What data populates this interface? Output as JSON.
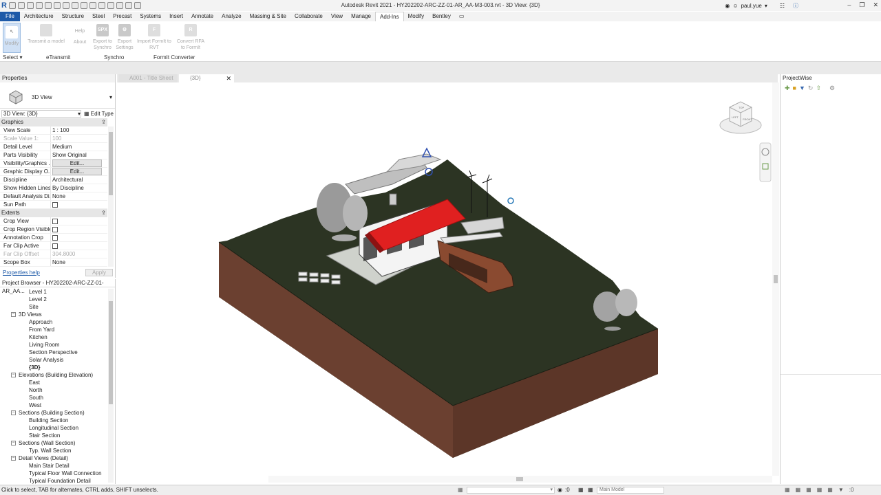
{
  "app": {
    "title": "Autodesk Revit 2021 - HY202202-ARC-ZZ-01-AR_AA-M3-003.rvt - 3D View: {3D}",
    "user": "paul.yue",
    "logo": "R"
  },
  "menu": {
    "tabs": [
      "File",
      "Architecture",
      "Structure",
      "Steel",
      "Precast",
      "Systems",
      "Insert",
      "Annotate",
      "Analyze",
      "Massing & Site",
      "Collaborate",
      "View",
      "Manage",
      "Add-Ins",
      "Modify",
      "Bentley"
    ],
    "active": "Add-Ins"
  },
  "ribbon": {
    "modify": "Modify",
    "transmit": "Transmit a model",
    "help": "Help",
    "about": "About",
    "export_synchro": "Export to Synchro",
    "export_settings": "Export Settings",
    "import_formit": "Import FormIt to RVT",
    "convert_rfa": "Convert RFA to FormIt",
    "spx_icon": "SPX",
    "panels": {
      "select": "Select",
      "etransmit": "eTransmit",
      "synchro": "Synchro",
      "formit": "FormIt Converter"
    }
  },
  "properties": {
    "title": "Properties",
    "type": "3D View",
    "selector": "3D View: {3D}",
    "edit_type": "Edit Type",
    "groups": {
      "graphics": "Graphics",
      "extents": "Extents"
    },
    "graphics_rows": [
      {
        "k": "View Scale",
        "v": "1 : 100"
      },
      {
        "k": "Scale Value    1:",
        "v": "100"
      },
      {
        "k": "Detail Level",
        "v": "Medium"
      },
      {
        "k": "Parts Visibility",
        "v": "Show Original"
      },
      {
        "k": "Visibility/Graphics ...",
        "v": "Edit..."
      },
      {
        "k": "Graphic Display O...",
        "v": "Edit..."
      },
      {
        "k": "Discipline",
        "v": "Architectural"
      },
      {
        "k": "Show Hidden Lines",
        "v": "By Discipline"
      },
      {
        "k": "Default Analysis Di...",
        "v": "None"
      },
      {
        "k": "Sun Path",
        "v": ""
      }
    ],
    "extents_rows": [
      {
        "k": "Crop View",
        "v": ""
      },
      {
        "k": "Crop Region Visible",
        "v": ""
      },
      {
        "k": "Annotation Crop",
        "v": ""
      },
      {
        "k": "Far Clip Active",
        "v": ""
      },
      {
        "k": "Far Clip Offset",
        "v": "304.8000"
      },
      {
        "k": "Scope Box",
        "v": "None"
      }
    ],
    "help": "Properties help",
    "apply": "Apply"
  },
  "browser": {
    "title": "Project Browser - HY202202-ARC-ZZ-01-AR_AA...",
    "items": [
      {
        "label": "Level 1",
        "lvl": 2
      },
      {
        "label": "Level 2",
        "lvl": 2
      },
      {
        "label": "Site",
        "lvl": 2
      },
      {
        "label": "3D Views",
        "lvl": 1
      },
      {
        "label": "Approach",
        "lvl": 2
      },
      {
        "label": "From Yard",
        "lvl": 2
      },
      {
        "label": "Kitchen",
        "lvl": 2
      },
      {
        "label": "Living Room",
        "lvl": 2
      },
      {
        "label": "Section Perspective",
        "lvl": 2
      },
      {
        "label": "Solar Analysis",
        "lvl": 2
      },
      {
        "label": "{3D}",
        "lvl": 2
      },
      {
        "label": "Elevations (Building Elevation)",
        "lvl": 1
      },
      {
        "label": "East",
        "lvl": 2
      },
      {
        "label": "North",
        "lvl": 2
      },
      {
        "label": "South",
        "lvl": 2
      },
      {
        "label": "West",
        "lvl": 2
      },
      {
        "label": "Sections (Building Section)",
        "lvl": 1
      },
      {
        "label": "Building Section",
        "lvl": 2
      },
      {
        "label": "Longitudinal Section",
        "lvl": 2
      },
      {
        "label": "Stair Section",
        "lvl": 2
      },
      {
        "label": "Sections (Wall Section)",
        "lvl": 1
      },
      {
        "label": "Typ. Wall Section",
        "lvl": 2
      },
      {
        "label": "Detail Views (Detail)",
        "lvl": 1
      },
      {
        "label": "Main Stair Detail",
        "lvl": 2
      },
      {
        "label": "Typical Floor Wall Connection",
        "lvl": 2
      },
      {
        "label": "Typical Foundation Detail",
        "lvl": 2
      }
    ]
  },
  "view_tabs": [
    "A001 - Title Sheet",
    "{3D}"
  ],
  "projectwise": {
    "title": "ProjectWise"
  },
  "viewcube": {
    "top": "TOP",
    "front": "FRONT",
    "left": "LEFT"
  },
  "status": {
    "text": "Click to select, TAB for alternates, CTRL adds, SHIFT unselects.",
    "zero": ":0",
    "model": "Main Model"
  },
  "colors": {
    "accent": "#1e5aa8",
    "terrain": "#2c3423",
    "soil": "#6b4030",
    "roof": "#e02020"
  }
}
